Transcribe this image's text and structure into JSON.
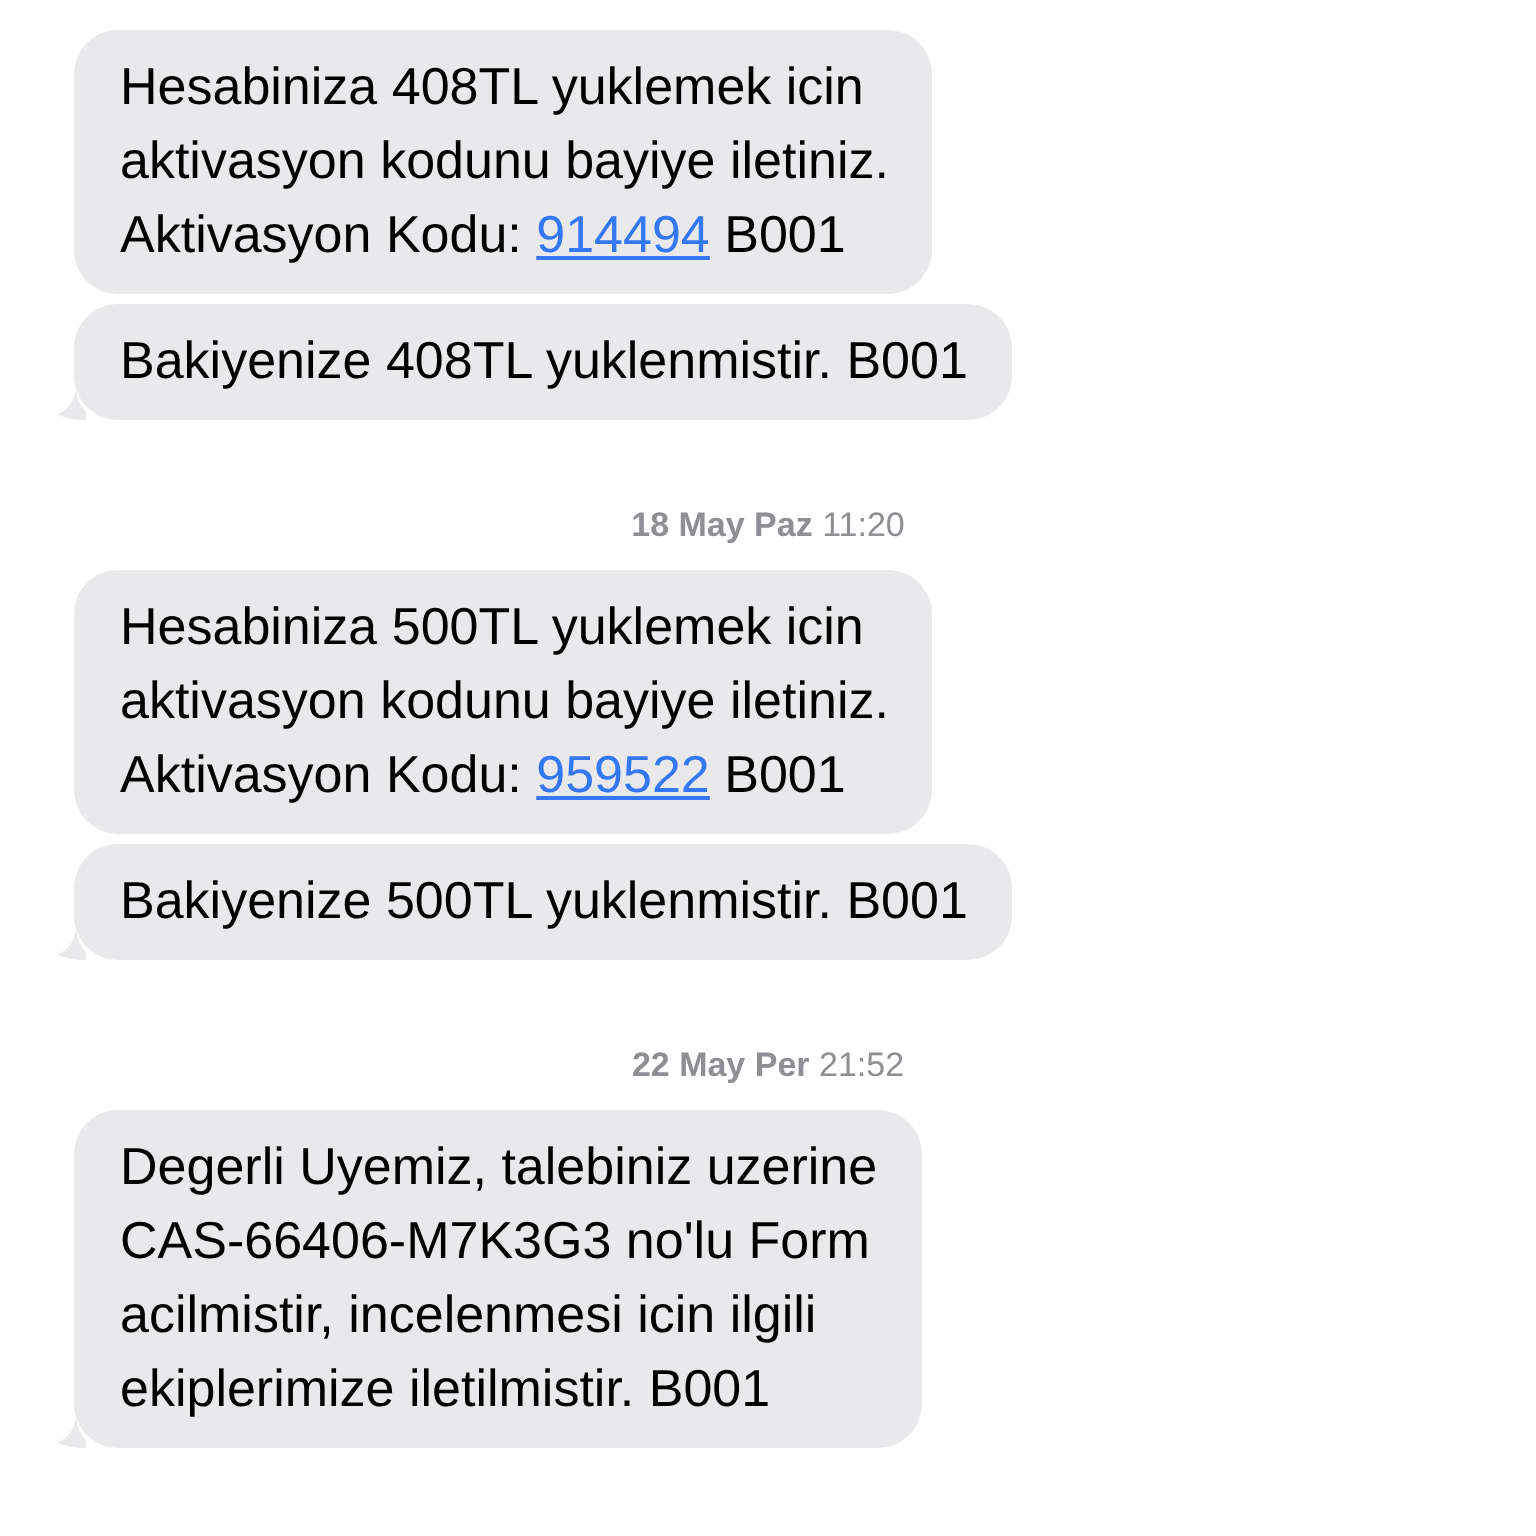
{
  "messages": [
    {
      "kind": "bubble",
      "tail": false,
      "parts": [
        {
          "kind": "text",
          "text": "Hesabiniza 408TL yuklemek icin\naktivasyon kodunu bayiye iletiniz.\nAktivasyon Kodu: "
        },
        {
          "kind": "link",
          "text": "914494"
        },
        {
          "kind": "text",
          "text": " B001"
        }
      ]
    },
    {
      "kind": "bubble",
      "tail": true,
      "parts": [
        {
          "kind": "text",
          "text": "Bakiyenize 408TL yuklenmistir. B001"
        }
      ]
    },
    {
      "kind": "timestamp",
      "text": "**18 May Paz** 11:20"
    },
    {
      "kind": "bubble",
      "tail": false,
      "parts": [
        {
          "kind": "text",
          "text": "Hesabiniza 500TL yuklemek icin\naktivasyon kodunu bayiye iletiniz.\nAktivasyon Kodu: "
        },
        {
          "kind": "link",
          "text": "959522"
        },
        {
          "kind": "text",
          "text": " B001"
        }
      ]
    },
    {
      "kind": "bubble",
      "tail": true,
      "parts": [
        {
          "kind": "text",
          "text": "Bakiyenize 500TL yuklenmistir. B001"
        }
      ]
    },
    {
      "kind": "timestamp",
      "text": "**22 May Per** 21:52"
    },
    {
      "kind": "bubble",
      "tail": true,
      "parts": [
        {
          "kind": "text",
          "text": "Degerli Uyemiz, talebiniz uzerine\nCAS-66406-M7K3G3 no'lu Form\nacilmistir, incelenmesi icin ilgili\nekiplerimize iletilmistir. B001"
        }
      ]
    }
  ]
}
